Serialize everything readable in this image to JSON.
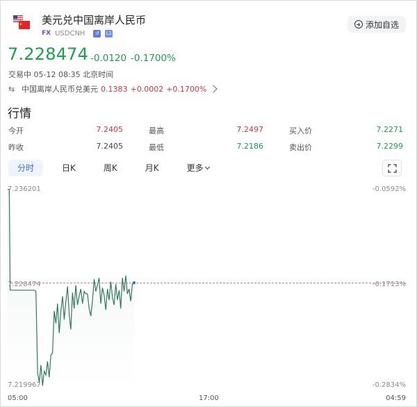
{
  "instrument": {
    "name": "美元兑中国离岸人民币",
    "market_tag": "FX",
    "code": "USDCNH",
    "badges": [
      "↺",
      "L1"
    ],
    "add_watchlist_label": "添加自选"
  },
  "quote": {
    "price": "7.228474",
    "change": "-0.0120",
    "change_pct": "-0.1700%",
    "status": "交易中 05-12 08:35 北京时间",
    "cross_pair": {
      "name": "中国离岸人民币兑美元",
      "price": "0.1383",
      "change": "+0.0002",
      "change_pct": "+0.1700%"
    }
  },
  "market": {
    "title": "行情",
    "rows": [
      {
        "l1": "今开",
        "v1": "7.2405",
        "l2": "最高",
        "v2": "7.2497",
        "l3": "买入价",
        "v3": "7.2271"
      },
      {
        "l1": "昨收",
        "v1": "7.2405",
        "l2": "最低",
        "v2": "7.2186",
        "l3": "卖出价",
        "v3": "7.2299"
      }
    ]
  },
  "tabs": [
    {
      "label": "分时",
      "active": true
    },
    {
      "label": "日K",
      "active": false
    },
    {
      "label": "周K",
      "active": false
    },
    {
      "label": "月K",
      "active": false
    },
    {
      "label": "更多",
      "active": false
    }
  ],
  "colors": {
    "up": "#d8343d",
    "down": "#1c9e4b",
    "line": "#2e7a5a",
    "fill_top": "#eef4f1",
    "ref_line": "#e06b6b",
    "accent": "#3b6fe0"
  },
  "chart_data": {
    "type": "line",
    "y_left_labels": [
      "7.236201",
      "7.228474",
      "7.219967"
    ],
    "y_right_labels": [
      "-0.0592%",
      "-0.1713%",
      "-0.2834%"
    ],
    "x_labels": [
      "05:00",
      "17:00",
      "04:59"
    ],
    "ylim": [
      7.219967,
      7.236201
    ],
    "reference_value": 7.2405,
    "points_span_minutes": 1439,
    "series": [
      {
        "t": [
          0,
          1,
          1.5,
          2,
          3,
          4,
          5,
          6,
          7,
          8,
          9,
          10,
          11,
          12,
          13,
          14,
          15,
          16,
          17,
          18,
          19,
          20,
          21,
          22,
          23,
          24,
          25,
          26,
          27,
          28,
          29,
          30,
          31,
          32,
          33,
          34,
          35,
          36,
          37,
          38,
          39,
          40,
          41,
          42,
          43,
          44,
          45,
          46,
          47,
          48,
          49,
          50,
          51,
          52,
          53,
          54,
          55,
          56,
          57,
          58,
          59,
          60,
          61,
          62,
          63,
          64,
          65,
          66,
          67,
          68,
          69,
          70,
          71,
          72,
          73,
          74,
          75,
          76
        ],
        "values": [
          7.2361,
          7.2361,
          7.2279,
          7.2279,
          7.2279,
          7.2279,
          7.2279,
          7.2279,
          7.2279,
          7.2279,
          7.2279,
          7.2279,
          7.2279,
          7.2279,
          7.2279,
          7.2279,
          7.2279,
          7.2279,
          7.2278,
          7.2212,
          7.2204,
          7.2218,
          7.2201,
          7.2213,
          7.221,
          7.2221,
          7.2208,
          7.2226,
          7.2228,
          7.2262,
          7.2252,
          7.2268,
          7.2244,
          7.2262,
          7.2274,
          7.2255,
          7.227,
          7.2282,
          7.2259,
          7.2247,
          7.2277,
          7.2264,
          7.2283,
          7.2267,
          7.2274,
          7.228,
          7.2268,
          7.2278,
          7.2276,
          7.2276,
          7.2264,
          7.2258,
          7.2271,
          7.2288,
          7.2278,
          7.2283,
          7.2289,
          7.2268,
          7.2281,
          7.2275,
          7.2263,
          7.228,
          7.2271,
          7.2286,
          7.2273,
          7.2267,
          7.2284,
          7.2271,
          7.2279,
          7.2264,
          7.2289,
          7.2278,
          7.2291,
          7.2276,
          7.228,
          7.227,
          7.2284,
          7.2285
        ]
      }
    ]
  }
}
